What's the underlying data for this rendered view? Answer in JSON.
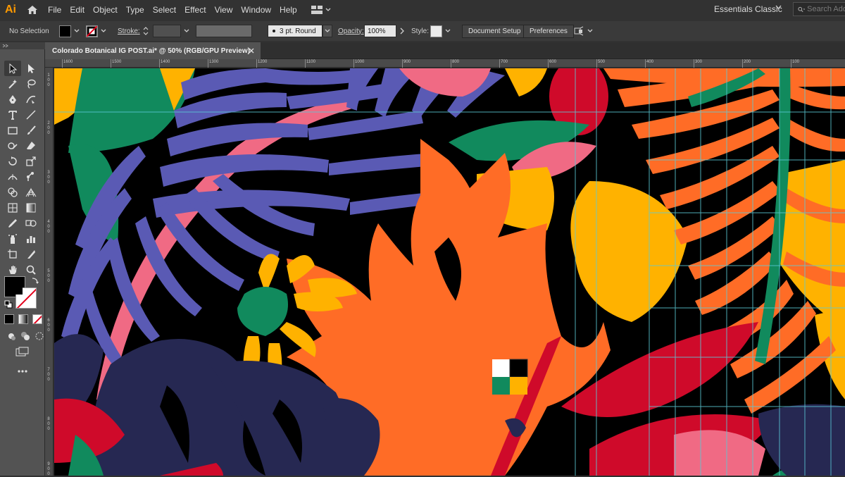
{
  "app": {
    "logo": "Ai"
  },
  "menu": {
    "items": [
      "File",
      "Edit",
      "Object",
      "Type",
      "Select",
      "Effect",
      "View",
      "Window",
      "Help"
    ]
  },
  "workspace": {
    "name": "Essentials Classic"
  },
  "search": {
    "placeholder": "Search Ado"
  },
  "controlbar": {
    "selection": "No Selection",
    "stroke_label": "Stroke:",
    "brush": "3 pt. Round",
    "opacity_label": "Opacity:",
    "opacity_value": "100%",
    "style_label": "Style:",
    "document_setup": "Document Setup",
    "preferences": "Preferences"
  },
  "document": {
    "tab_title": "Colorado Botanical IG POST.ai* @ 50% (RGB/GPU Preview)"
  },
  "ruler": {
    "top_labels": [
      "1600",
      "1500",
      "1400",
      "1300",
      "1200",
      "1100",
      "1000",
      "900",
      "800",
      "700",
      "600",
      "500",
      "400",
      "300",
      "200",
      "100"
    ],
    "left_labels": [
      "1\n0\n0",
      "2\n0\n0",
      "3\n0\n0",
      "4\n0\n0",
      "5\n0\n0",
      "6\n0\n0",
      "7\n0\n0",
      "8\n0\n0",
      "9\n0\n0"
    ]
  },
  "colors": {
    "accent_orange": "#ff6c26",
    "leaf_blue": "#5a5ab4",
    "pink": "#f06a84",
    "green": "#118a5d",
    "yellow": "#ffb200",
    "red": "#cf0a2a",
    "navy": "#262852"
  }
}
